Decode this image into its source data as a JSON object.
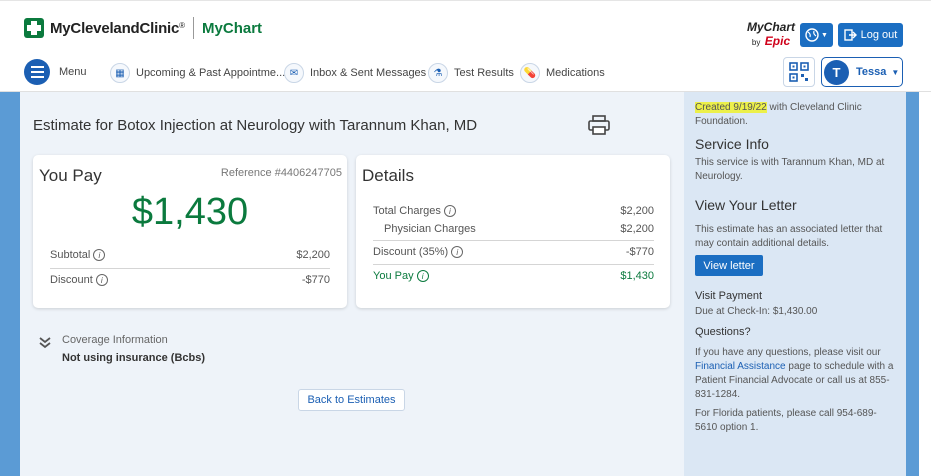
{
  "header": {
    "brand": "MyClevelandClinic",
    "brand_mark": "®",
    "app_name": "MyChart",
    "epic_top": "MyChart",
    "epic_by": "by",
    "epic_name": "Epic",
    "logout_label": "Log out"
  },
  "nav": {
    "menu_label": "Menu",
    "items": [
      {
        "label": "Upcoming & Past Appointme..."
      },
      {
        "label": "Inbox & Sent Messages"
      },
      {
        "label": "Test Results"
      },
      {
        "label": "Medications"
      }
    ],
    "user_initial": "T",
    "user_name": "Tessa"
  },
  "estimate": {
    "title": "Estimate for Botox Injection at Neurology with Tarannum Khan, MD",
    "you_pay": {
      "title": "You Pay",
      "reference": "Reference #4406247705",
      "amount": "$1,430",
      "subtotal_label": "Subtotal",
      "subtotal_value": "$2,200",
      "discount_label": "Discount",
      "discount_value": "-$770"
    },
    "details": {
      "title": "Details",
      "total_label": "Total Charges",
      "total_value": "$2,200",
      "physician_label": "Physician Charges",
      "physician_value": "$2,200",
      "discount_label": "Discount (35%)",
      "discount_value": "-$770",
      "you_pay_label": "You Pay",
      "you_pay_value": "$1,430"
    },
    "coverage": {
      "label": "Coverage Information",
      "value": "Not using insurance (Bcbs)"
    },
    "back_label": "Back to Estimates"
  },
  "sidebar": {
    "created_highlight": "Created 9/19/22",
    "created_rest": " with Cleveland Clinic Foundation.",
    "service_heading": "Service Info",
    "service_text": "This service is with Tarannum Khan, MD at Neurology.",
    "letter_heading": "View Your Letter",
    "letter_text": "This estimate has an associated letter that may contain additional details.",
    "letter_button": "View letter",
    "visit_heading": "Visit Payment",
    "visit_text": "Due at Check-In: $1,430.00",
    "questions_heading": "Questions?",
    "questions_pre": "If you have any questions, please visit our ",
    "questions_link": "Financial Assistance",
    "questions_post": " page to schedule with a Patient Financial Advocate or call us at 855-831-1284.",
    "florida_text": "For Florida patients, please call 954-689-5610 option 1."
  },
  "colors": {
    "brand_green": "#0b7a3e",
    "accent_blue": "#1b6ec2",
    "highlight": "#ecf04a"
  }
}
